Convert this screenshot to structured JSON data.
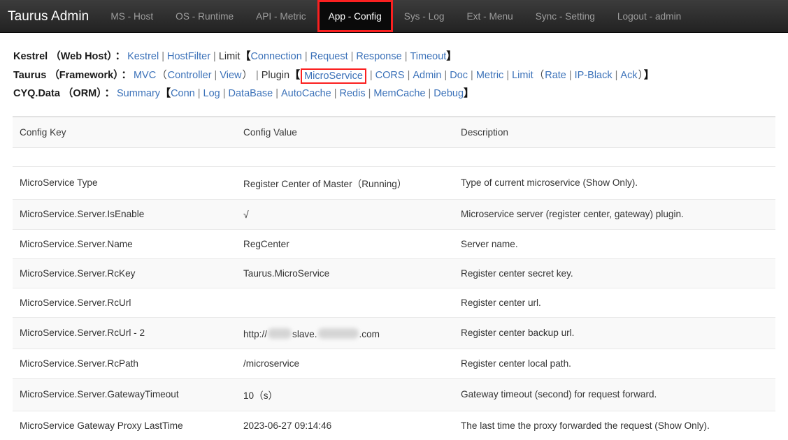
{
  "navbar": {
    "brand": "Taurus Admin",
    "items": [
      {
        "label": "MS - Host",
        "active": false
      },
      {
        "label": "OS - Runtime",
        "active": false
      },
      {
        "label": "API - Metric",
        "active": false
      },
      {
        "label": "App - Config",
        "active": true
      },
      {
        "label": "Sys - Log",
        "active": false
      },
      {
        "label": "Ext - Menu",
        "active": false
      },
      {
        "label": "Sync - Setting",
        "active": false
      },
      {
        "label": "Logout - admin",
        "active": false
      }
    ],
    "active_highlight_color": "#fb1f1f"
  },
  "link_rows": [
    {
      "name": "Kestrel",
      "scope": "（Web Host）",
      "colon": "：",
      "tokens": [
        {
          "type": "link",
          "text": "Kestrel"
        },
        {
          "type": "sep",
          "text": "|"
        },
        {
          "type": "link",
          "text": "HostFilter"
        },
        {
          "type": "sep",
          "text": "|"
        },
        {
          "type": "plain",
          "text": "Limit"
        },
        {
          "type": "brk",
          "text": "【"
        },
        {
          "type": "link",
          "text": "Connection"
        },
        {
          "type": "sep",
          "text": "|"
        },
        {
          "type": "link",
          "text": "Request"
        },
        {
          "type": "sep",
          "text": "|"
        },
        {
          "type": "link",
          "text": "Response"
        },
        {
          "type": "sep",
          "text": "|"
        },
        {
          "type": "link",
          "text": "Timeout"
        },
        {
          "type": "brk",
          "text": "】"
        }
      ]
    },
    {
      "name": "Taurus",
      "scope": "（Framework）",
      "colon": "：",
      "tokens": [
        {
          "type": "link",
          "text": "MVC"
        },
        {
          "type": "paren",
          "text": "（"
        },
        {
          "type": "link",
          "text": "Controller"
        },
        {
          "type": "sep",
          "text": "|"
        },
        {
          "type": "link",
          "text": "View"
        },
        {
          "type": "paren",
          "text": "）"
        },
        {
          "type": "sep",
          "text": "|"
        },
        {
          "type": "plain",
          "text": "Plugin"
        },
        {
          "type": "brk",
          "text": "【"
        },
        {
          "type": "link-highlight",
          "text": "MicroService"
        },
        {
          "type": "sep",
          "text": "|"
        },
        {
          "type": "link",
          "text": "CORS"
        },
        {
          "type": "sep",
          "text": "|"
        },
        {
          "type": "link",
          "text": "Admin"
        },
        {
          "type": "sep",
          "text": "|"
        },
        {
          "type": "link",
          "text": "Doc"
        },
        {
          "type": "sep",
          "text": "|"
        },
        {
          "type": "link",
          "text": "Metric"
        },
        {
          "type": "sep",
          "text": "|"
        },
        {
          "type": "link",
          "text": "Limit"
        },
        {
          "type": "paren",
          "text": "（"
        },
        {
          "type": "link",
          "text": "Rate"
        },
        {
          "type": "sep",
          "text": "|"
        },
        {
          "type": "link",
          "text": "IP-Black"
        },
        {
          "type": "sep",
          "text": "|"
        },
        {
          "type": "link",
          "text": "Ack"
        },
        {
          "type": "paren",
          "text": "）"
        },
        {
          "type": "brk",
          "text": "】"
        }
      ]
    },
    {
      "name": "CYQ.Data",
      "scope": "（ORM）",
      "colon": "：",
      "tokens": [
        {
          "type": "link",
          "text": "Summary"
        },
        {
          "type": "brk",
          "text": "【"
        },
        {
          "type": "link",
          "text": "Conn"
        },
        {
          "type": "sep",
          "text": "|"
        },
        {
          "type": "link",
          "text": "Log"
        },
        {
          "type": "sep",
          "text": "|"
        },
        {
          "type": "link",
          "text": "DataBase"
        },
        {
          "type": "sep",
          "text": "|"
        },
        {
          "type": "link",
          "text": "AutoCache"
        },
        {
          "type": "sep",
          "text": "|"
        },
        {
          "type": "link",
          "text": "Redis"
        },
        {
          "type": "sep",
          "text": "|"
        },
        {
          "type": "link",
          "text": "MemCache"
        },
        {
          "type": "sep",
          "text": "|"
        },
        {
          "type": "link",
          "text": "Debug"
        },
        {
          "type": "brk",
          "text": "】"
        }
      ]
    }
  ],
  "table": {
    "headers": [
      "Config Key",
      "Config Value",
      "Description"
    ],
    "rows": [
      {
        "key": "MicroService Type",
        "value": "Register Center of Master（Running）",
        "desc": "Type of current microservice (Show Only)."
      },
      {
        "key": "MicroService.Server.IsEnable",
        "value": "√",
        "desc": "Microservice server (register center, gateway) plugin."
      },
      {
        "key": "MicroService.Server.Name",
        "value": "RegCenter",
        "desc": "Server name."
      },
      {
        "key": "MicroService.Server.RcKey",
        "value": "Taurus.MicroService",
        "desc": "Register center secret key."
      },
      {
        "key": "MicroService.Server.RcUrl",
        "value": "",
        "desc": "Register center url."
      },
      {
        "key": "MicroService.Server.RcUrl - 2",
        "value": "http://",
        "value_suffix_1": "slave.",
        "value_suffix_2": ".com",
        "redacted": true,
        "desc": "Register center backup url."
      },
      {
        "key": "MicroService.Server.RcPath",
        "value": "/microservice",
        "desc": "Register center local path."
      },
      {
        "key": "MicroService.Server.GatewayTimeout",
        "value": "10（s）",
        "desc": "Gateway timeout (second) for request forward."
      },
      {
        "key": "MicroService Gateway Proxy LastTime",
        "value": "2023-06-27 09:14:46",
        "desc": "The last time the proxy forwarded the request (Show Only)."
      }
    ]
  }
}
